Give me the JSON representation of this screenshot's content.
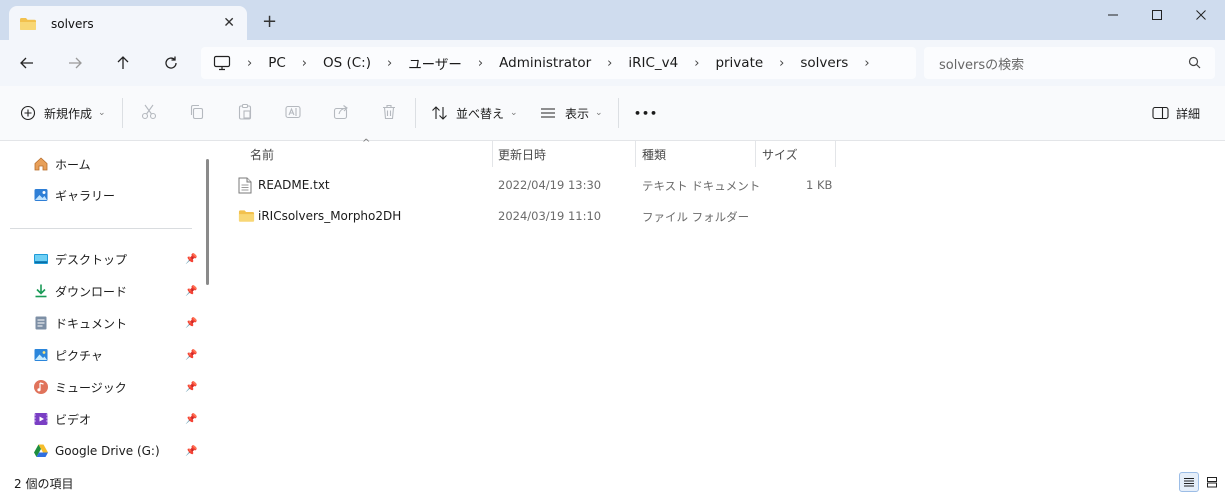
{
  "window": {
    "tab_title": "solvers",
    "new_tab": "+",
    "close_tab": "✕"
  },
  "address": {
    "crumbs": [
      "PC",
      "OS (C:)",
      "ユーザー",
      "Administrator",
      "iRIC_v4",
      "private",
      "solvers"
    ]
  },
  "search": {
    "placeholder": "solversの検索"
  },
  "toolbar": {
    "new_label": "新規作成",
    "sort_label": "並べ替え",
    "view_label": "表示",
    "more_label": "•••",
    "details_label": "詳細"
  },
  "sidebar": {
    "home": "ホーム",
    "gallery": "ギャラリー",
    "items": [
      {
        "label": "デスクトップ",
        "icon": "desktop-icon"
      },
      {
        "label": "ダウンロード",
        "icon": "download-icon"
      },
      {
        "label": "ドキュメント",
        "icon": "document-icon"
      },
      {
        "label": "ピクチャ",
        "icon": "pictures-icon"
      },
      {
        "label": "ミュージック",
        "icon": "music-icon"
      },
      {
        "label": "ビデオ",
        "icon": "video-icon"
      },
      {
        "label": "Google Drive (G:)",
        "icon": "google-drive-icon"
      }
    ]
  },
  "columns": {
    "name": "名前",
    "modified": "更新日時",
    "type": "種類",
    "size": "サイズ"
  },
  "files": [
    {
      "name": "README.txt",
      "modified": "2022/04/19 13:30",
      "type": "テキスト ドキュメント",
      "size": "1 KB",
      "icon": "text-file-icon"
    },
    {
      "name": "iRICsolvers_Morpho2DH",
      "modified": "2024/03/19 11:10",
      "type": "ファイル フォルダー",
      "size": "",
      "icon": "folder-icon"
    }
  ],
  "status": {
    "item_count": "2 個の項目"
  },
  "colors": {
    "titlebar_bg": "#cfdcee",
    "folder_yellow": "#f2c14e",
    "accent_blue": "#0067c0"
  }
}
